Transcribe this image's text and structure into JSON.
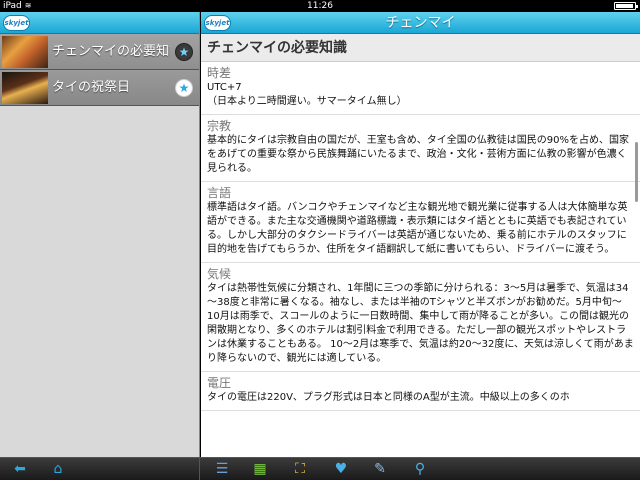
{
  "status_bar": {
    "device": "iPad",
    "time": "11:26"
  },
  "logo_text": "skyjet",
  "left_menu": {
    "items": [
      {
        "label": "チェンマイの必要知識",
        "thumb": "temple-photo",
        "star_icon": "star-icon",
        "selected": true
      },
      {
        "label": "タイの祝祭日",
        "thumb": "festival-photo",
        "star_icon": "star-icon",
        "selected": false
      }
    ]
  },
  "header": {
    "title": "チェンマイ"
  },
  "content": {
    "page_title": "チェンマイの必要知識",
    "sections": [
      {
        "heading": "時差",
        "body": "UTC+7\n（日本より二時間遅い。サマータイム無し）"
      },
      {
        "heading": "宗教",
        "body": "基本的にタイは宗教自由の国だが、王室も含め、タイ全国の仏教徒は国民の90%を占め、国家をあげての重要な祭から民族舞踊にいたるまで、政治・文化・芸術方面に仏教の影響が色濃く見られる。"
      },
      {
        "heading": "言語",
        "body": "標準語はタイ語。バンコクやチェンマイなど主な観光地で観光業に従事する人は大体簡単な英語ができる。また主な交通機関や道路標識・表示類にはタイ語とともに英語でも表記されている。しかし大部分のタクシードライバーは英語が通じないため、乗る前にホテルのスタッフに目的地を告げてもらうか、住所をタイ語翻訳して紙に書いてもらい、ドライバーに渡そう。"
      },
      {
        "heading": "気候",
        "body": "タイは熱帯性気候に分類され、1年間に三つの季節に分けられる：3～5月は暑季で、気温は34～38度と非常に暑くなる。袖なし、または半袖のTシャツと半ズボンがお勧めだ。5月中旬～10月は雨季で、スコールのように一日数時間、集中して雨が降ることが多い。この間は観光の閑散期となり、多くのホテルは割引料金で利用できる。ただし一部の観光スポットやレストランは休業することもある。 10～2月は寒季で、気温は約20～32度に、天気は涼しくて雨があまり降らないので、観光には適している。"
      },
      {
        "heading": "電圧",
        "body": "タイの電圧は220V、プラグ形式は日本と同様のA型が主流。中級以上の多くのホ"
      }
    ]
  },
  "toolbar": {
    "left": [
      {
        "name": "back-arrow-icon",
        "glyph": "⬅",
        "color": "#2aa8e0"
      },
      {
        "name": "home-icon",
        "glyph": "⌂",
        "color": "#2aa8e0"
      }
    ],
    "right": [
      {
        "name": "list-icon",
        "glyph": "☰",
        "color": "#6aa0d8"
      },
      {
        "name": "grid-icon",
        "glyph": "▦",
        "color": "#7ac943"
      },
      {
        "name": "map-icon",
        "glyph": "⛶",
        "color": "#e8c040"
      },
      {
        "name": "favorite-heart-icon",
        "glyph": "♥",
        "color": "#4ab0e8"
      },
      {
        "name": "notes-icon",
        "glyph": "✎",
        "color": "#8ab8e8"
      },
      {
        "name": "search-icon",
        "glyph": "⚲",
        "color": "#4ab0e8"
      }
    ]
  }
}
